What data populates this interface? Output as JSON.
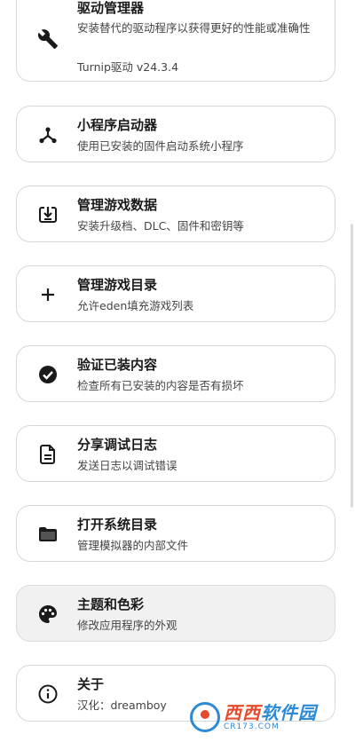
{
  "menu": {
    "driver": {
      "title": "驱动管理器",
      "desc": "安装替代的驱动程序以获得更好的性能或准确性",
      "extra": "Turnip驱动  v24.3.4",
      "icon": "wrench-icon"
    },
    "applet": {
      "title": "小程序启动器",
      "desc": "使用已安装的固件启动系统小程序",
      "icon": "applet-hub-icon"
    },
    "game_data": {
      "title": "管理游戏数据",
      "desc": "安装升级档、DLC、固件和密钥等",
      "icon": "install-icon"
    },
    "game_dir": {
      "title": "管理游戏目录",
      "desc": "允许eden填充游戏列表",
      "icon": "plus-icon"
    },
    "verify": {
      "title": "验证已装内容",
      "desc": "检查所有已安装的内容是否有损坏",
      "icon": "check-circle-icon"
    },
    "share_log": {
      "title": "分享调试日志",
      "desc": "发送日志以调试错误",
      "icon": "document-icon"
    },
    "open_dir": {
      "title": "打开系统目录",
      "desc": "管理模拟器的内部文件",
      "icon": "folder-icon"
    },
    "theme": {
      "title": "主题和色彩",
      "desc": "修改应用程序的外观",
      "icon": "palette-icon"
    },
    "about": {
      "title": "关于",
      "desc": "汉化：dreamboy",
      "icon": "info-icon"
    }
  },
  "watermark": {
    "main_a": "西西",
    "main_b": "软件园",
    "sub": "CR173.COM"
  },
  "colors": {
    "card_border": "#d8d8d8",
    "highlight_bg": "#f1f1f1",
    "watermark_blue": "#2c8ad6",
    "watermark_red": "#e44b2c"
  }
}
